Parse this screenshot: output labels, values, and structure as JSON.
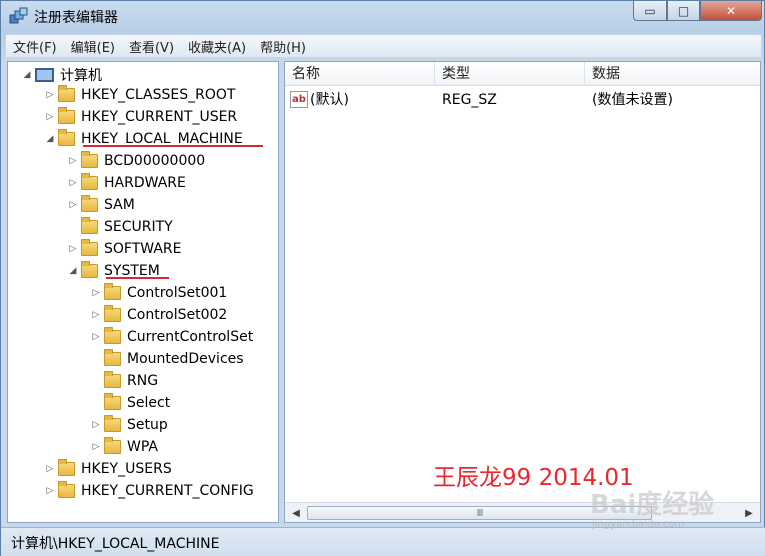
{
  "window": {
    "title": "注册表编辑器",
    "minimize_glyph": "▭",
    "maximize_glyph": "□",
    "close_glyph": "✕"
  },
  "menu": [
    "文件(F)",
    "编辑(E)",
    "查看(V)",
    "收藏夹(A)",
    "帮助(H)"
  ],
  "tree": {
    "root": "计算机",
    "items": [
      {
        "label": "HKEY_CLASSES_ROOT",
        "arrow": "▷",
        "underlined": false
      },
      {
        "label": "HKEY_CURRENT_USER",
        "arrow": "▷",
        "underlined": false
      },
      {
        "label": "HKEY_LOCAL_MACHINE",
        "arrow": "◢",
        "underlined": true
      },
      {
        "label": "BCD00000000",
        "arrow": "▷",
        "underlined": false
      },
      {
        "label": "HARDWARE",
        "arrow": "▷",
        "underlined": false
      },
      {
        "label": "SAM",
        "arrow": "▷",
        "underlined": false
      },
      {
        "label": "SECURITY",
        "arrow": "",
        "underlined": false
      },
      {
        "label": "SOFTWARE",
        "arrow": "▷",
        "underlined": false
      },
      {
        "label": "SYSTEM",
        "arrow": "◢",
        "underlined": true
      },
      {
        "label": "ControlSet001",
        "arrow": "▷",
        "underlined": false
      },
      {
        "label": "ControlSet002",
        "arrow": "▷",
        "underlined": false
      },
      {
        "label": "CurrentControlSet",
        "arrow": "▷",
        "underlined": false
      },
      {
        "label": "MountedDevices",
        "arrow": "",
        "underlined": false
      },
      {
        "label": "RNG",
        "arrow": "",
        "underlined": false
      },
      {
        "label": "Select",
        "arrow": "",
        "underlined": false
      },
      {
        "label": "Setup",
        "arrow": "▷",
        "underlined": false
      },
      {
        "label": "WPA",
        "arrow": "▷",
        "underlined": false
      },
      {
        "label": "HKEY_USERS",
        "arrow": "▷",
        "underlined": false
      },
      {
        "label": "HKEY_CURRENT_CONFIG",
        "arrow": "▷",
        "underlined": false
      }
    ]
  },
  "list": {
    "columns": [
      "名称",
      "类型",
      "数据"
    ],
    "rows": [
      {
        "icon": "ab",
        "name": "(默认)",
        "type": "REG_SZ",
        "data": "(数值未设置)"
      }
    ]
  },
  "watermark": "王辰龙99 2014.01",
  "scroll": {
    "left": "◀",
    "right": "▶",
    "thumb": "III"
  },
  "status": "计算机\\HKEY_LOCAL_MACHINE",
  "baidu": {
    "logo": "Bai度经验",
    "url": "jingyan.baidu.com"
  },
  "colors": {
    "underline": "#d42a36",
    "watermark": "#e8282e"
  }
}
